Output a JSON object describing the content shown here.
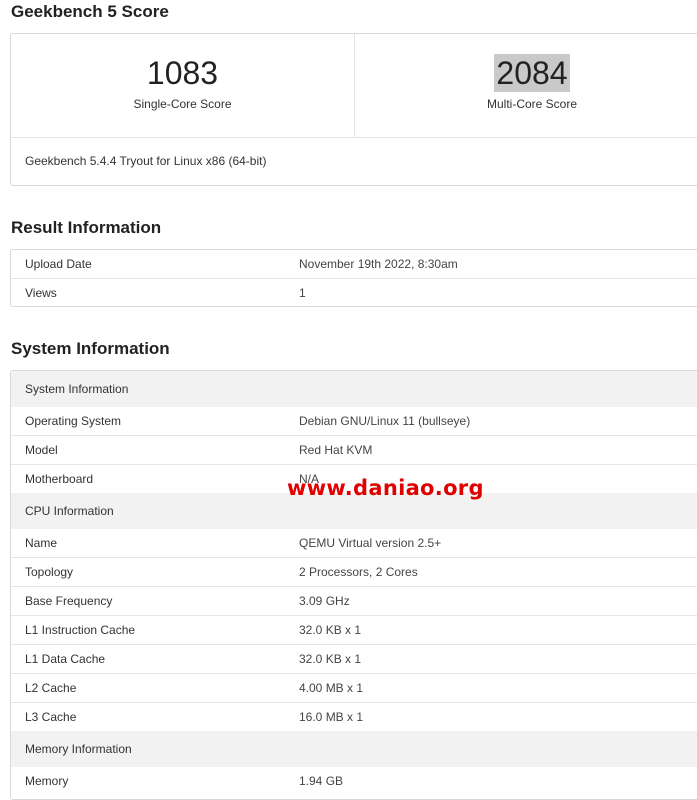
{
  "geekbench": {
    "title": "Geekbench 5 Score",
    "single_core_score": "1083",
    "single_core_label": "Single-Core Score",
    "multi_core_score": "2084",
    "multi_core_label": "Multi-Core Score",
    "version": "Geekbench 5.4.4 Tryout for Linux x86 (64-bit)"
  },
  "result": {
    "title": "Result Information",
    "rows": [
      {
        "key": "Upload Date",
        "value": "November 19th 2022, 8:30am"
      },
      {
        "key": "Views",
        "value": "1"
      }
    ]
  },
  "system": {
    "title": "System Information",
    "sections": [
      {
        "header": "System Information",
        "rows": [
          {
            "key": "Operating System",
            "value": "Debian GNU/Linux 11 (bullseye)"
          },
          {
            "key": "Model",
            "value": "Red Hat KVM"
          },
          {
            "key": "Motherboard",
            "value": "N/A"
          }
        ]
      },
      {
        "header": "CPU Information",
        "rows": [
          {
            "key": "Name",
            "value": "QEMU Virtual version 2.5+"
          },
          {
            "key": "Topology",
            "value": "2 Processors, 2 Cores"
          },
          {
            "key": "Base Frequency",
            "value": "3.09 GHz"
          },
          {
            "key": "L1 Instruction Cache",
            "value": "32.0 KB x 1"
          },
          {
            "key": "L1 Data Cache",
            "value": "32.0 KB x 1"
          },
          {
            "key": "L2 Cache",
            "value": "4.00 MB x 1"
          },
          {
            "key": "L3 Cache",
            "value": "16.0 MB x 1"
          }
        ]
      },
      {
        "header": "Memory Information",
        "rows": [
          {
            "key": "Memory",
            "value": "1.94 GB"
          }
        ]
      }
    ]
  },
  "watermark": "www.daniao.org"
}
